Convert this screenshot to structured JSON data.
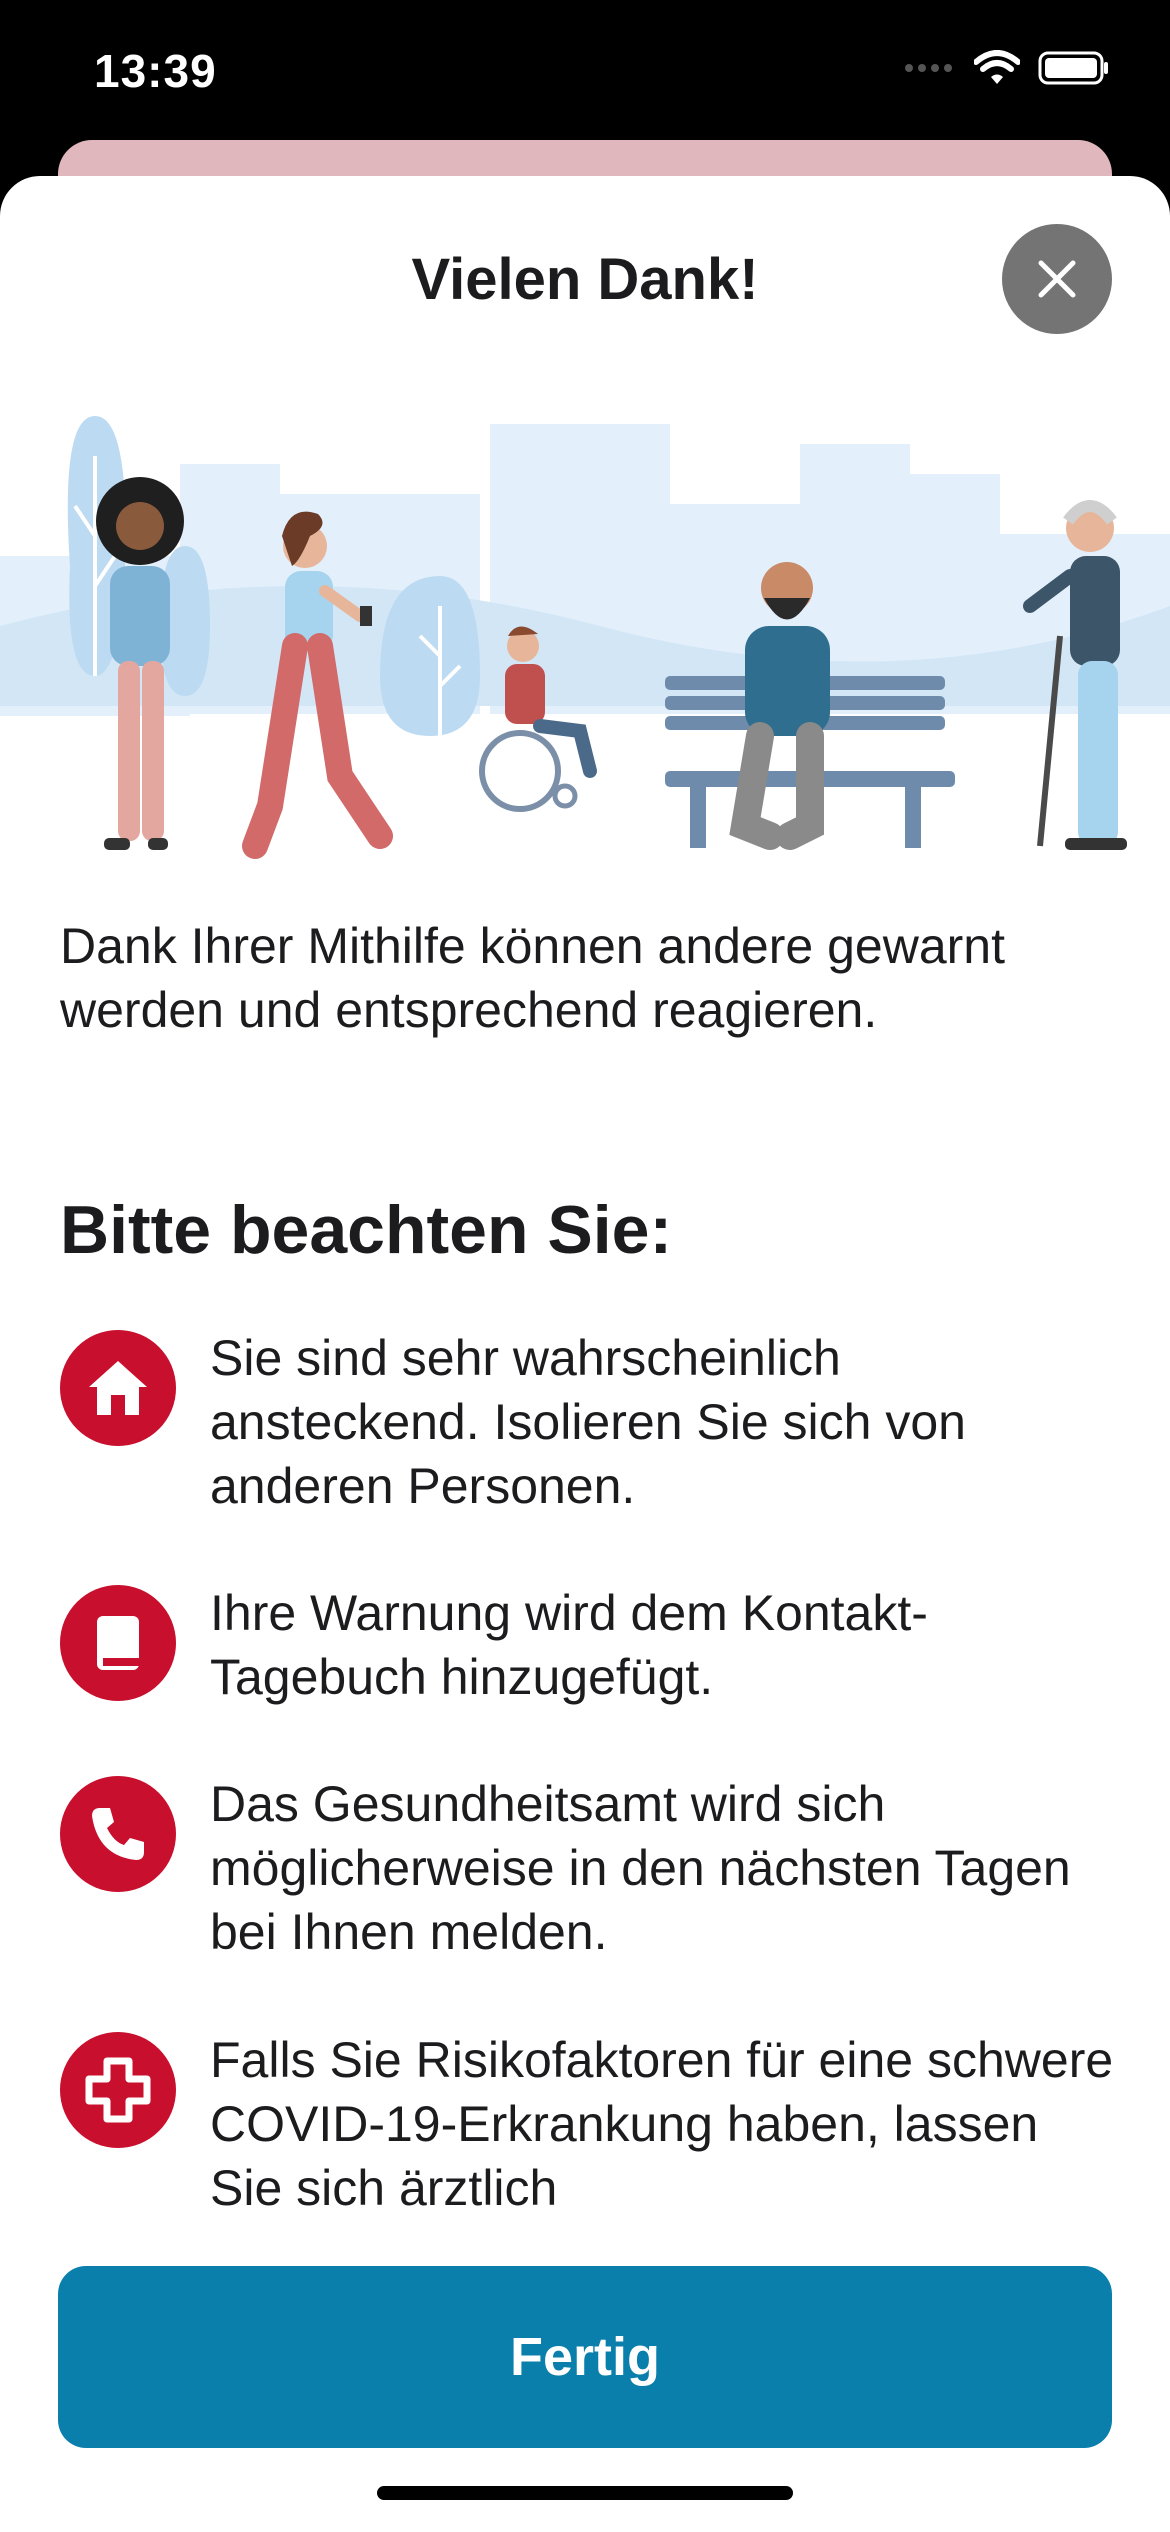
{
  "status_bar": {
    "time": "13:39"
  },
  "modal": {
    "title": "Vielen Dank!",
    "close_icon": "close-icon",
    "intro": "Dank Ihrer Mithilfe können andere gewarnt werden und entsprechend reagieren.",
    "notice_heading": "Bitte beachten Sie:",
    "items": [
      {
        "icon": "home-icon",
        "text": "Sie sind sehr wahrscheinlich ansteckend. Isolieren Sie sich von anderen Personen."
      },
      {
        "icon": "book-icon",
        "text": "Ihre Warnung wird dem Kontakt-Tagebuch hinzugefügt."
      },
      {
        "icon": "phone-icon",
        "text": "Das Gesundheitsamt wird sich möglicherweise in den nächsten Tagen bei Ihnen melden."
      },
      {
        "icon": "medical-cross-icon",
        "text": "Falls Sie Risikofaktoren für eine schwere COVID-19-Erkrankung haben, lassen Sie sich ärztlich"
      }
    ],
    "done_label": "Fertig"
  },
  "colors": {
    "accent_red": "#c8102e",
    "button_blue": "#0a7fac",
    "close_grey": "#747474"
  }
}
